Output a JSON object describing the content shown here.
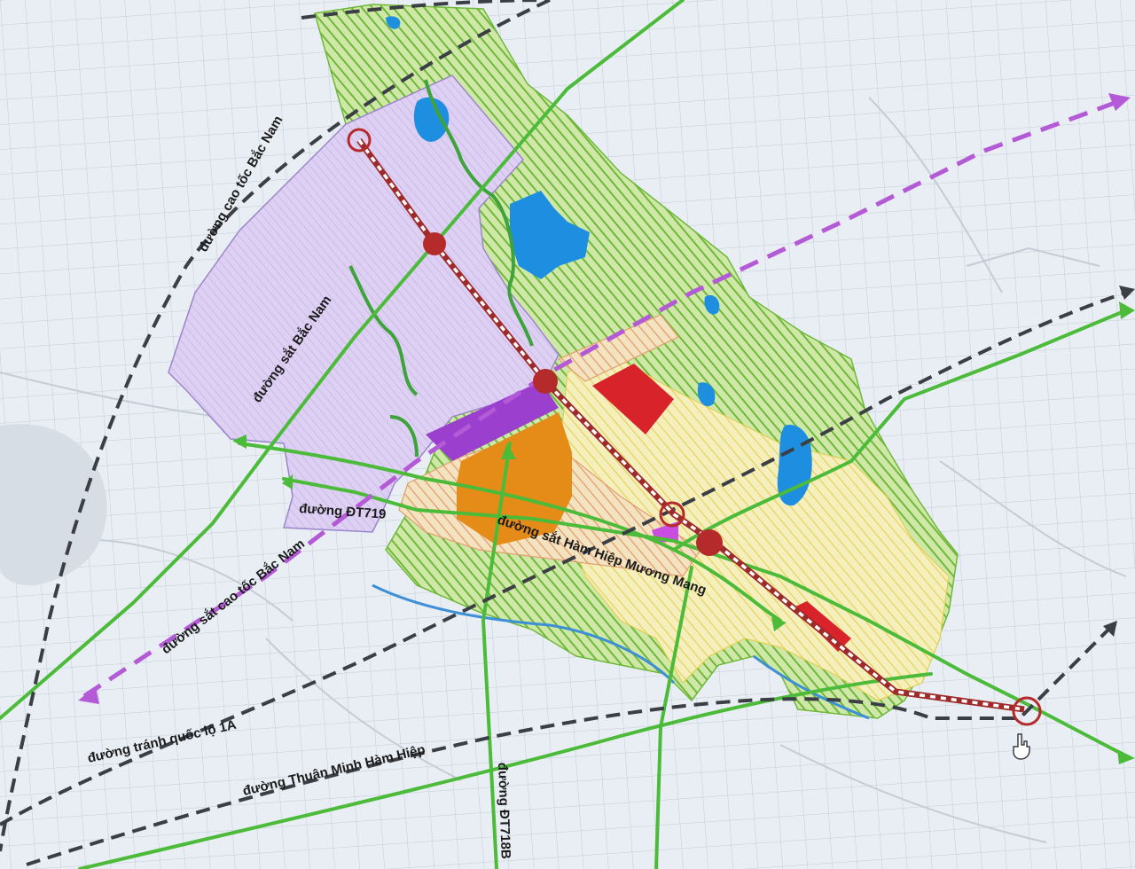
{
  "map": {
    "labels": {
      "expressway_north_south": "đường cao tốc Bắc Nam",
      "railway_north_south": "đường sắt Bắc Nam",
      "road_dt719": "đường ĐT719",
      "high_speed_railway": "đường sắt cao tốc Bắc Nam",
      "railway_ham_hiep_muong_mang": "đường sắt Hàm Hiệp Mương Mang",
      "bypass_national_road_1a": "đường tránh quốc lộ 1A",
      "road_thuan_minh_ham_hiep": "đường Thuận Minh Hàm Hiệp",
      "road_dt718b": "đường ĐT718B"
    },
    "colors": {
      "background": "#e9eef4",
      "grid": "#b9c6d3",
      "green_zone": "#9ccd5a",
      "lilac_zone": "#d9c6f0",
      "yellow_zone": "#f2eaa6",
      "water": "#1e8ee0",
      "green_road": "#4cbb3a",
      "dark_dashed_route": "#3b3e44",
      "purple_dashed_route": "#b45ad6",
      "railway_red": "#9e2a2a",
      "station_red": "#b52a2a",
      "red_block": "#d8232a",
      "orange_block": "#e58b18",
      "purple_block": "#9b3fcf",
      "magenta_block": "#c94de0"
    },
    "icons": [
      "hand-cursor-icon",
      "arrowhead-icon",
      "station-marker-icon"
    ]
  }
}
